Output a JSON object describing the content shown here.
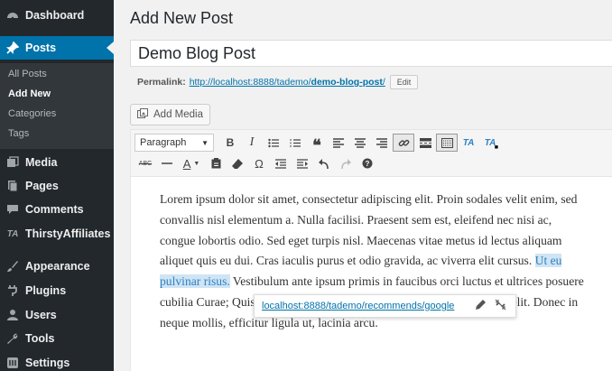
{
  "sidebar": {
    "items": [
      {
        "label": "Dashboard",
        "icon": "dashboard-icon"
      },
      {
        "label": "Posts",
        "icon": "pin-icon"
      },
      {
        "label": "Media",
        "icon": "media-icon"
      },
      {
        "label": "Pages",
        "icon": "pages-icon"
      },
      {
        "label": "Comments",
        "icon": "comments-icon"
      },
      {
        "label": "ThirstyAffiliates",
        "icon": "ta-icon"
      },
      {
        "label": "Appearance",
        "icon": "brush-icon"
      },
      {
        "label": "Plugins",
        "icon": "plugin-icon"
      },
      {
        "label": "Users",
        "icon": "users-icon"
      },
      {
        "label": "Tools",
        "icon": "wrench-icon"
      },
      {
        "label": "Settings",
        "icon": "settings-icon"
      }
    ],
    "submenu": [
      "All Posts",
      "Add New",
      "Categories",
      "Tags"
    ]
  },
  "page": {
    "title": "Add New Post",
    "post_title": "Demo Blog Post",
    "permalink_label": "Permalink:",
    "permalink_base": "http://localhost:8888/tademo/",
    "permalink_slug": "demo-blog-post",
    "permalink_end": "/",
    "edit_label": "Edit",
    "add_media_label": "Add Media"
  },
  "editor": {
    "format_select": "Paragraph",
    "ta_label": "TA",
    "text_before": "Lorem ipsum dolor sit amet, consectetur adipiscing elit. Proin sodales velit enim, sed convallis nisl elementum a. Nulla facilisi. Praesent sem est, eleifend nec nisi ac, congue lobortis odio. Sed eget turpis nisl. Maecenas vitae metus id lectus aliquam aliquet quis eu dui. Cras iaculis purus et odio gravida, ac viverra elit cursus. ",
    "text_selected": "Ut eu pulvinar risus.",
    "text_after": " Vestibulum ante ipsum primis in faucibus orci luctus et ultrices posuere cubilia Curae; Quisque vitae mi maximus, vestibulum arcu a, rhoncus velit. Donec in neque mollis, efficitur ligula ut, lacinia arcu.",
    "link_url": "localhost:8888/tademo/recommends/google"
  }
}
